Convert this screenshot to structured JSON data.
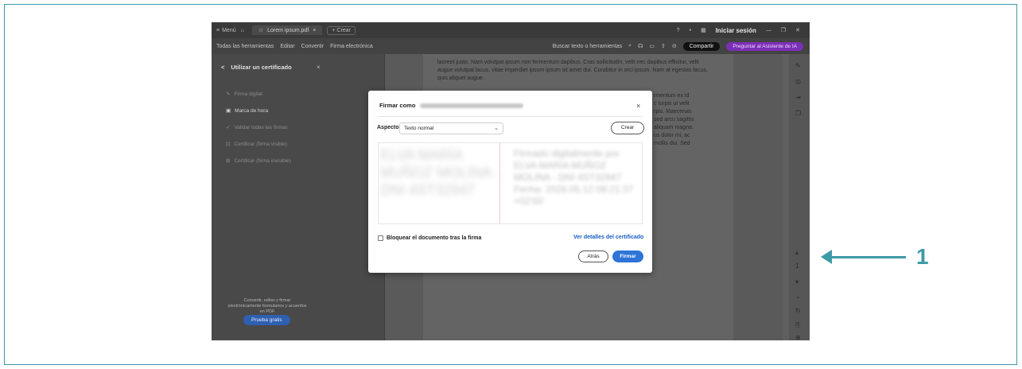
{
  "titlebar": {
    "menu_label": "Menú",
    "tab_title": "Lorem ipsum.pdf",
    "tab_close": "×",
    "new_tab": "+ Crear",
    "signin": "Iniciar sesión"
  },
  "menubar": {
    "items": [
      "Todas las herramientas",
      "Editar",
      "Convertir",
      "Firma electrónica"
    ],
    "search_placeholder": "Buscar texto o herramientas",
    "share": "Compartir",
    "ai_assistant": "Preguntar al Asistente de IA"
  },
  "left_panel": {
    "title": "Utilizar un certificado",
    "back": "<",
    "close": "×",
    "items": [
      {
        "label": "Firma digital",
        "active": false
      },
      {
        "label": "Marca de hora",
        "active": true
      },
      {
        "label": "Validar todas las firmas",
        "active": false
      },
      {
        "label": "Certificar (firma visible)",
        "active": false
      },
      {
        "label": "Certificar (firma invisible)",
        "active": false
      }
    ],
    "footer": "Convertir, editar y firmar electrónicamente formularios y acuerdos en PDF",
    "trial_button": "Prueba gratis"
  },
  "document": {
    "para1": "laoreet justo. Nam volutpat ipsum non fermentum dapibus. Cras sollicitudin, velit nec dapibus efficitur, velit augue volutpat lacus, vitae imperdiet ipsum ipsum sit amet dui. Curabitur in orci ipsum. Nam at egestas lacus, quis aliquet augue.",
    "frag1": "rmentum ex id",
    "frag2": "c turpis ut velit",
    "frag3": "rpis. Maecenas",
    "frag4": "sed arcu sagittis",
    "frag5": "aliquam magna.",
    "frag6": "us dolor mi, ac",
    "frag7": "mollis dui. Sed"
  },
  "dialog": {
    "title": "Firmar como",
    "close": "×",
    "aspect_label": "Aspecto",
    "aspect_value": "Texto normal",
    "create_button": "Crear",
    "preview_left": "ELVA MARÍA MUÑOZ MOLINA - DNI 4ST32947",
    "preview_right": "Firmado digitalmente por ELVA MARIA MUÑOZ MOLINA - DNI 4ST32947 Fecha: 2026.05.12 08:21:37 +02'00'",
    "lock_label": "Bloquear el documento tras la firma",
    "cert_link": "Ver detalles del certificado",
    "back_button": "Atrás",
    "sign_button": "Firmar"
  },
  "callout": {
    "number": "1"
  },
  "colors": {
    "frame": "#3d9aa6",
    "primary_blue": "#2d74d6",
    "link_blue": "#1a5fc4"
  }
}
